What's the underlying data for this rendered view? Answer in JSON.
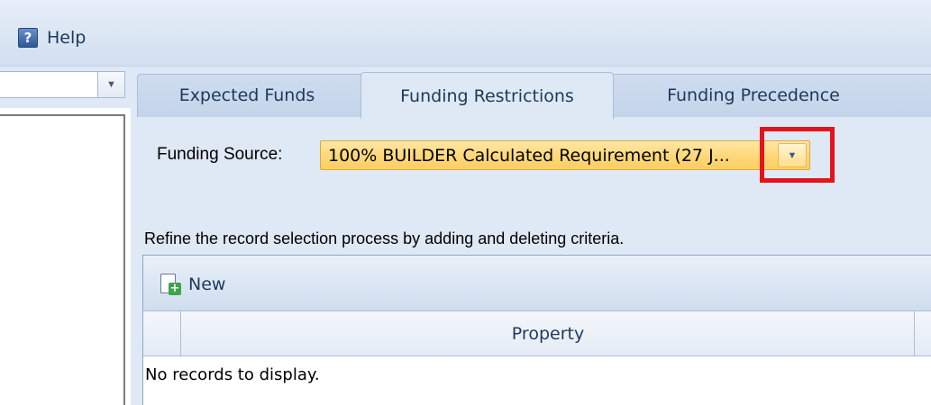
{
  "menu": {
    "help_label": "Help",
    "help_icon": "help-icon"
  },
  "left_pane": {
    "combo_value": ""
  },
  "tabs": [
    {
      "label": "Expected Funds",
      "selected": false
    },
    {
      "label": "Funding Restrictions",
      "selected": true
    },
    {
      "label": "Funding Precedence",
      "selected": false
    }
  ],
  "funding_source": {
    "label": "Funding Source:",
    "value": "100% BUILDER Calculated Requirement (27 J..."
  },
  "criteria": {
    "instruction": "Refine the record selection process by adding and deleting criteria.",
    "new_label": "New",
    "columns": [
      "Property"
    ],
    "empty_text": "No records to display."
  },
  "colors": {
    "highlight": "#e3141b",
    "combo_fill": "#ffd87a",
    "panel_bg": "#dfe8f5"
  }
}
